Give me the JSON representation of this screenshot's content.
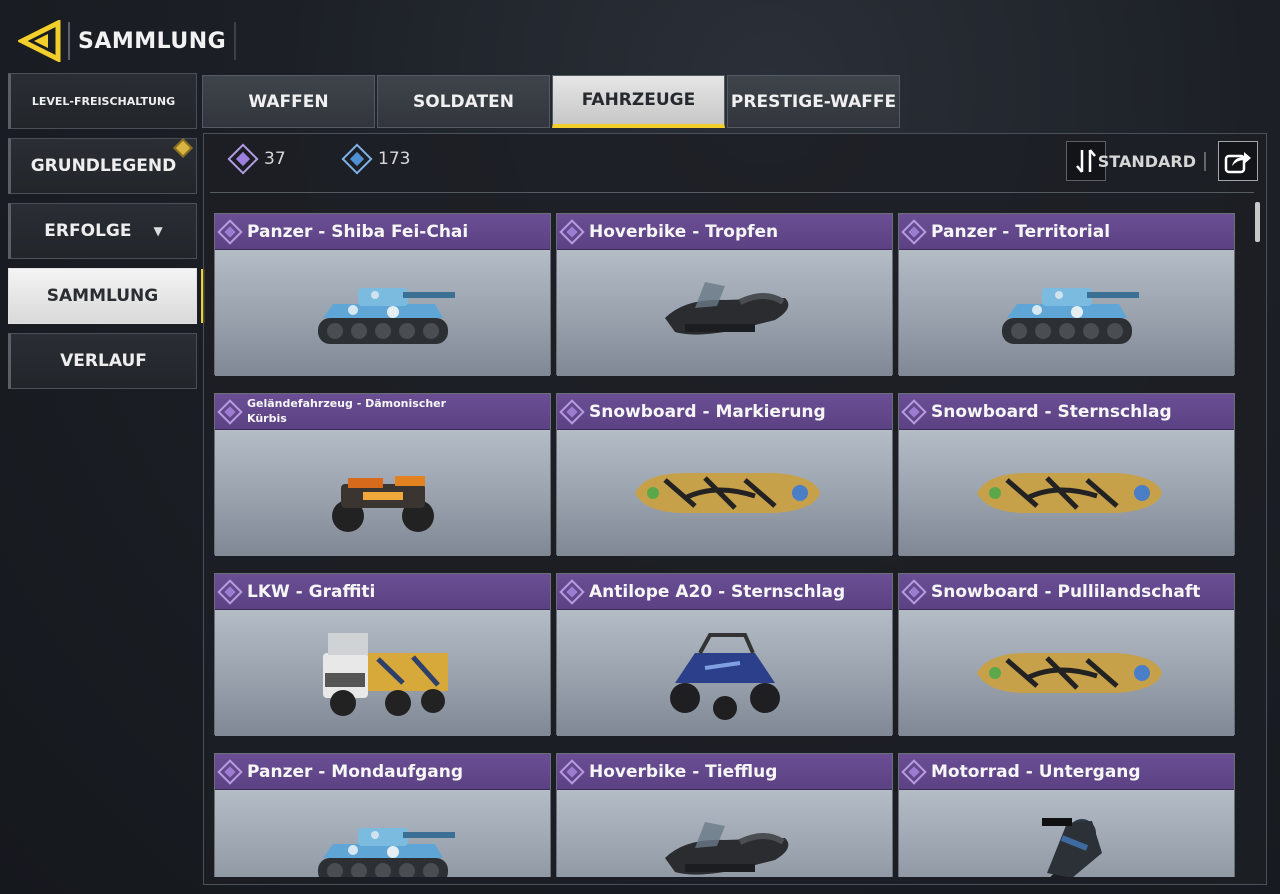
{
  "header": {
    "title": "SAMMLUNG"
  },
  "sidebar": {
    "items": [
      {
        "label": "LEVEL-FREISCHALTUNG"
      },
      {
        "label": "GRUNDLEGEND"
      },
      {
        "label": "ERFOLGE"
      },
      {
        "label": "SAMMLUNG"
      },
      {
        "label": "VERLAUF"
      }
    ]
  },
  "tabs": [
    {
      "label": "WAFFEN"
    },
    {
      "label": "SOLDATEN"
    },
    {
      "label": "FAHRZEUGE"
    },
    {
      "label": "PRESTIGE-WAFFE"
    }
  ],
  "toolbar": {
    "currency_purple": "37",
    "currency_blue": "173",
    "sort_label": "STANDARD"
  },
  "items": [
    {
      "title": "Panzer - Shiba Fei-Chai",
      "icon": "tank-icon"
    },
    {
      "title": "Hoverbike - Tropfen",
      "icon": "hoverbike-icon"
    },
    {
      "title": "Panzer - Territorial",
      "icon": "tank-icon"
    },
    {
      "title": "Geländefahrzeug - Dämonischer Kürbis",
      "icon": "atv-icon"
    },
    {
      "title": "Snowboard - Markierung",
      "icon": "snowboard-icon"
    },
    {
      "title": "Snowboard - Sternschlag",
      "icon": "snowboard-icon"
    },
    {
      "title": "LKW - Graffiti",
      "icon": "truck-icon"
    },
    {
      "title": "Antilope A20 - Sternschlag",
      "icon": "buggy-icon"
    },
    {
      "title": "Snowboard - Pullilandschaft",
      "icon": "snowboard-icon"
    },
    {
      "title": "Panzer - Mondaufgang",
      "icon": "tank-icon"
    },
    {
      "title": "Hoverbike - Tiefflug",
      "icon": "hoverbike-icon"
    },
    {
      "title": "Motorrad - Untergang",
      "icon": "motorcycle-icon"
    }
  ],
  "colors": {
    "accent": "#f2cf2b",
    "rarity_purple": "#6b4e95"
  }
}
